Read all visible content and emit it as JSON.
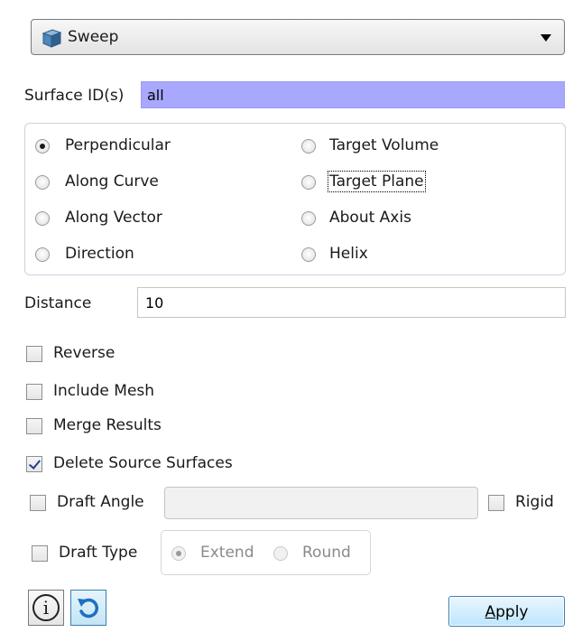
{
  "dropdown": {
    "selected": "Sweep",
    "icon": "cube-icon"
  },
  "surface": {
    "label": "Surface ID(s)",
    "value": "all"
  },
  "sweep_mode": {
    "options": [
      "Perpendicular",
      "Along Curve",
      "Along Vector",
      "Direction",
      "Target Volume",
      "Target Plane",
      "About Axis",
      "Helix"
    ],
    "selected": "Perpendicular",
    "focused": "Target Plane"
  },
  "distance": {
    "label": "Distance",
    "value": "10"
  },
  "checkboxes": {
    "reverse": {
      "label": "Reverse",
      "checked": false
    },
    "include_mesh": {
      "label": "Include Mesh",
      "checked": false
    },
    "merge_results": {
      "label": "Merge Results",
      "checked": false
    },
    "delete_source": {
      "label": "Delete Source Surfaces",
      "checked": true
    },
    "draft_angle": {
      "label": "Draft Angle",
      "checked": false
    },
    "rigid": {
      "label": "Rigid",
      "checked": false
    },
    "draft_type": {
      "label": "Draft Type",
      "checked": false
    }
  },
  "draft_type_options": {
    "extend": "Extend",
    "round": "Round",
    "selected": "Extend"
  },
  "buttons": {
    "info_icon": "info-icon",
    "reset_icon": "undo-icon",
    "apply_first": "A",
    "apply_rest": "pply"
  },
  "colors": {
    "selection": "#a9a8ff",
    "accent": "#3c7fb1"
  }
}
